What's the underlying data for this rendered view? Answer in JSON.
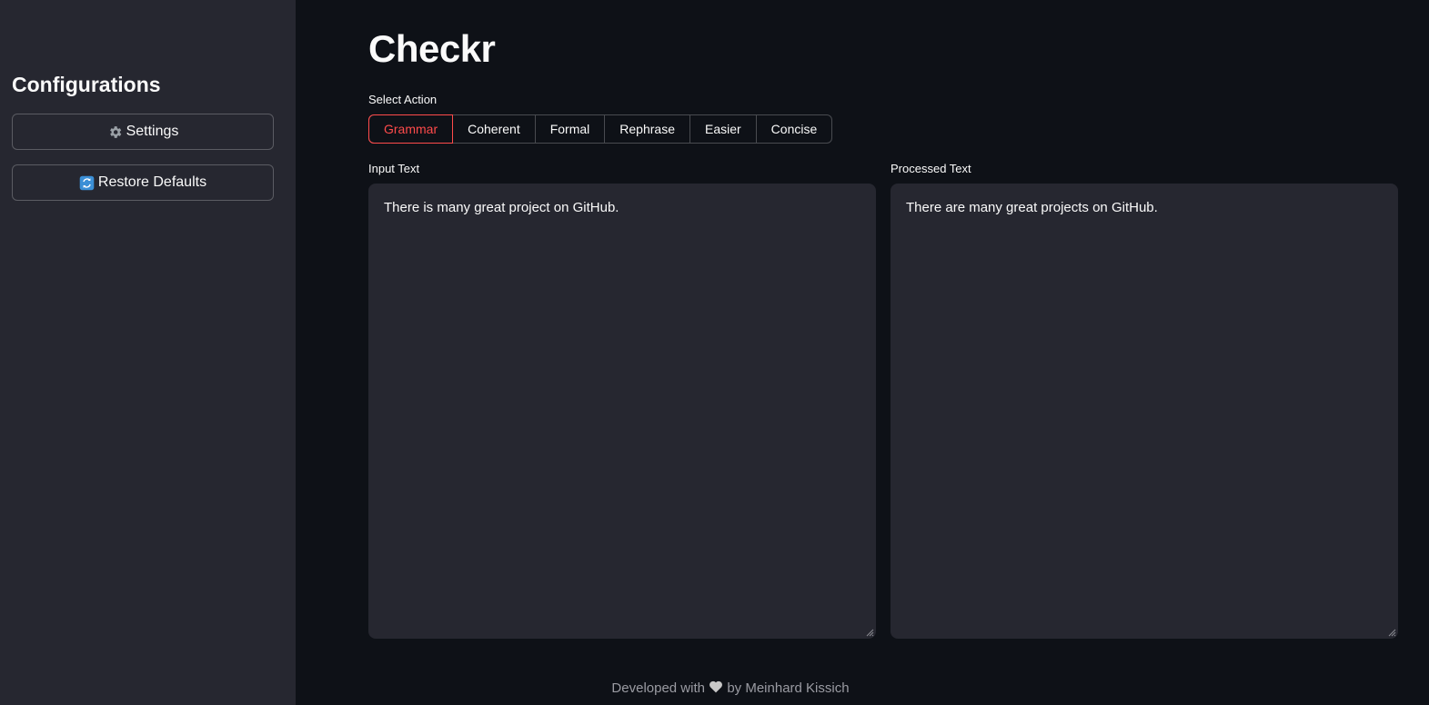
{
  "sidebar": {
    "title": "Configurations",
    "settings_label": "Settings",
    "settings_icon": "gear-icon",
    "restore_label": "Restore Defaults",
    "restore_icon": "refresh-icon"
  },
  "main": {
    "title": "Checkr",
    "action_label": "Select Action",
    "actions": [
      "Grammar",
      "Coherent",
      "Formal",
      "Rephrase",
      "Easier",
      "Concise"
    ],
    "selected_action": "Grammar",
    "input_label": "Input Text",
    "input_value": "There is many great project on GitHub.",
    "output_label": "Processed Text",
    "output_value": "There are many great projects on GitHub."
  },
  "footer": {
    "prefix": "Developed with",
    "suffix": "by Meinhard Kissich",
    "heart_icon": "heart-icon"
  },
  "colors": {
    "background": "#0e1117",
    "sidebar": "#262730",
    "accent": "#ff4b4b",
    "text": "#fafafa"
  }
}
